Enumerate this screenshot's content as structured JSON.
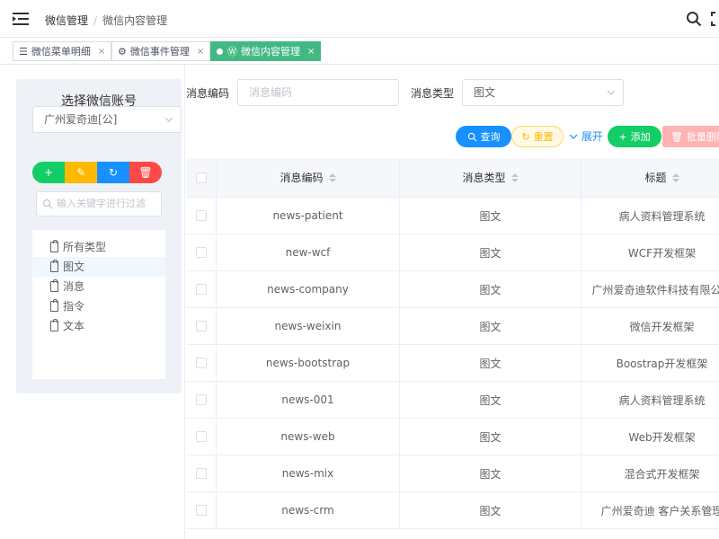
{
  "header": {
    "breadcrumb": [
      "微信管理",
      "微信内容管理"
    ],
    "separator": "/"
  },
  "tabs": [
    {
      "label": "微信菜单明细",
      "icon": "list-icon",
      "active": false
    },
    {
      "label": "微信事件管理",
      "icon": "gear-icon",
      "active": false
    },
    {
      "label": "微信内容管理",
      "icon": "wordpress-icon",
      "active": true
    }
  ],
  "tab_close": "×",
  "left_panel": {
    "title": "选择微信账号",
    "account": "广州爱奇迪[公]",
    "search_placeholder": "输入关键字进行过滤",
    "tree": [
      {
        "label": "所有类型",
        "selected": false
      },
      {
        "label": "图文",
        "selected": true
      },
      {
        "label": "消息",
        "selected": false
      },
      {
        "label": "指令",
        "selected": false
      },
      {
        "label": "文本",
        "selected": false
      }
    ]
  },
  "filters": {
    "code_label": "消息编码",
    "code_placeholder": "消息编码",
    "type_label": "消息类型",
    "type_value": "图文"
  },
  "actions": {
    "query": "查询",
    "reset": "重置",
    "expand": "展开",
    "add": "添加",
    "batch_delete": "批量删除"
  },
  "table": {
    "headers": [
      "消息编码",
      "消息类型",
      "标题"
    ],
    "rows": [
      [
        "news-patient",
        "图文",
        "病人资料管理系统"
      ],
      [
        "new-wcf",
        "图文",
        "WCF开发框架"
      ],
      [
        "news-company",
        "图文",
        "广州爱奇迪软件科技有限公司"
      ],
      [
        "news-weixin",
        "图文",
        "微信开发框架"
      ],
      [
        "news-bootstrap",
        "图文",
        "Boostrap开发框架"
      ],
      [
        "news-001",
        "图文",
        "病人资料管理系统"
      ],
      [
        "news-web",
        "图文",
        "Web开发框架"
      ],
      [
        "news-mix",
        "图文",
        "混合式开发框架"
      ],
      [
        "news-crm",
        "图文",
        "广州爱奇迪 客户关系管理"
      ]
    ]
  },
  "colors": {
    "accent": "#1890ff",
    "success": "#13ce66",
    "warning": "#ffba00",
    "danger": "#ff4949",
    "active_tab": "#42b983"
  }
}
